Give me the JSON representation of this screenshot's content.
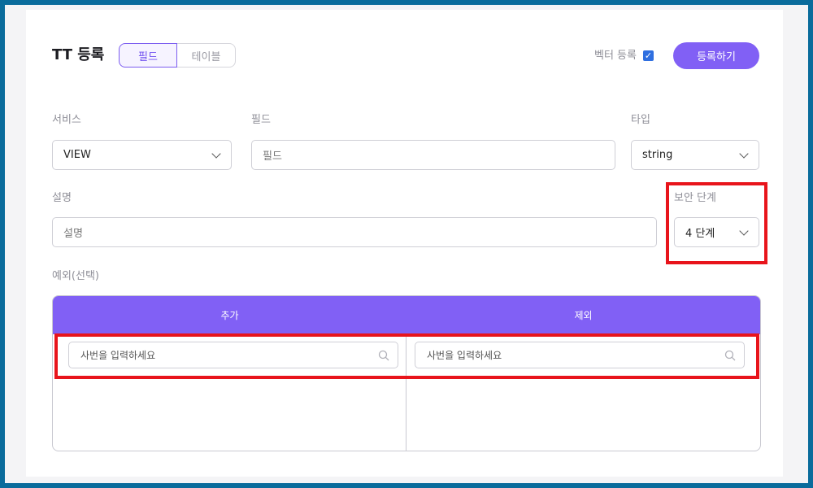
{
  "header": {
    "title": "TT 등록",
    "tabs": [
      {
        "label": "필드",
        "active": true
      },
      {
        "label": "테이블",
        "active": false
      }
    ],
    "vector_label": "벡터 등록",
    "vector_checked": true,
    "register_label": "등록하기"
  },
  "form": {
    "service": {
      "label": "서비스",
      "value": "VIEW"
    },
    "field": {
      "label": "필드",
      "placeholder": "필드"
    },
    "type": {
      "label": "타입",
      "value": "string"
    },
    "description": {
      "label": "설명",
      "placeholder": "설명"
    },
    "security": {
      "label": "보안 단계",
      "value": "4 단계"
    },
    "exception_label": "예외(선택)"
  },
  "exceptions": {
    "add_header": "추가",
    "exclude_header": "제외",
    "search_placeholder": "사번을 입력하세요"
  },
  "colors": {
    "accent": "#8160f5",
    "highlight": "#e8141b",
    "frame": "#0a6c9c"
  }
}
